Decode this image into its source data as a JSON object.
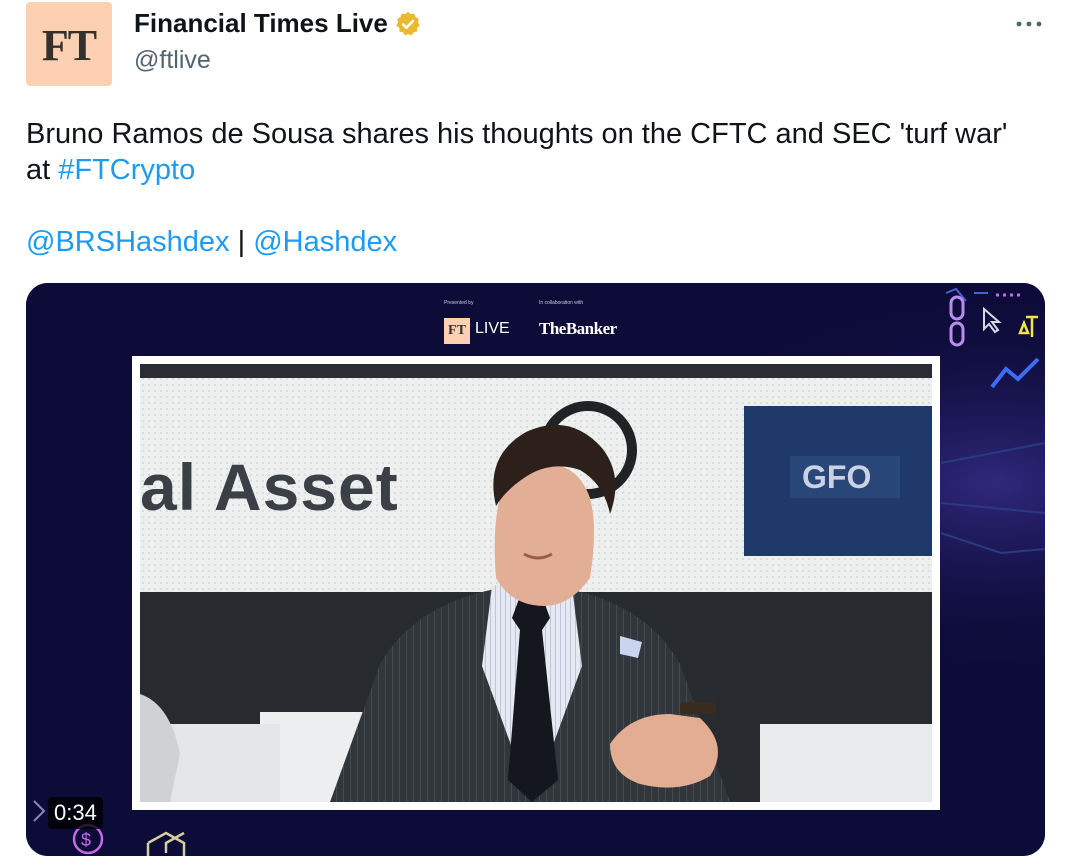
{
  "author": {
    "avatar_text": "FT",
    "display_name": "Financial Times Live",
    "handle": "@ftlive",
    "verified_icon": "gold-verified-badge-icon"
  },
  "more_icon": "more-options-icon",
  "tweet": {
    "text_prefix": "Bruno Ramos de Sousa shares his thoughts on the CFTC and SEC 'turf war' at ",
    "hashtag": "#FTCrypto",
    "mention_1": "@BRSHashdex",
    "separator": " | ",
    "mention_2": "@Hashdex"
  },
  "video": {
    "presented_by": "Presented by",
    "collaboration": "In collaboration with",
    "ft_badge": "FT",
    "ft_live": "LIVE",
    "the_banker": "TheBanker",
    "backdrop_text": "al Asset",
    "sponsor_logo": "GFO",
    "duration": "0:34"
  },
  "colors": {
    "link": "#1d9bf0",
    "avatar_bg": "#fcd0b1",
    "video_bg": "#0d0b38",
    "verified": "#e8b931"
  }
}
